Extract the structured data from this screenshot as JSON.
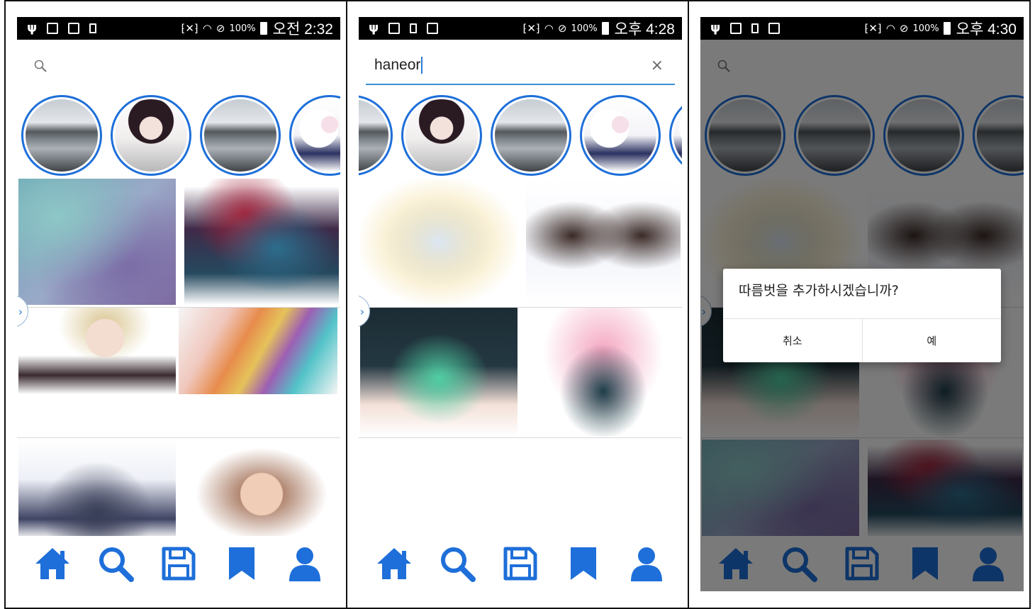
{
  "screens": [
    {
      "status": {
        "battery": "100%",
        "time": "오전 2:32"
      },
      "search": {
        "value": ""
      }
    },
    {
      "status": {
        "battery": "100%",
        "time": "오후 4:28"
      },
      "search": {
        "value": "haneor"
      }
    },
    {
      "status": {
        "battery": "100%",
        "time": "오후 4:30"
      },
      "search": {
        "value": ""
      },
      "dialog": {
        "message": "따름벗을 추가하시겠습니까?",
        "cancel_label": "취소",
        "confirm_label": "예"
      }
    }
  ],
  "icons": {
    "accent": "#1e6fd9",
    "nav": [
      "home-icon",
      "search-icon",
      "save-icon",
      "bookmark-icon",
      "profile-icon"
    ],
    "status": [
      "usb-icon",
      "gallery-icon",
      "sim-off-icon",
      "battery-saver-icon",
      "vibrate-icon",
      "wifi-icon",
      "block-icon",
      "battery-icon"
    ]
  }
}
